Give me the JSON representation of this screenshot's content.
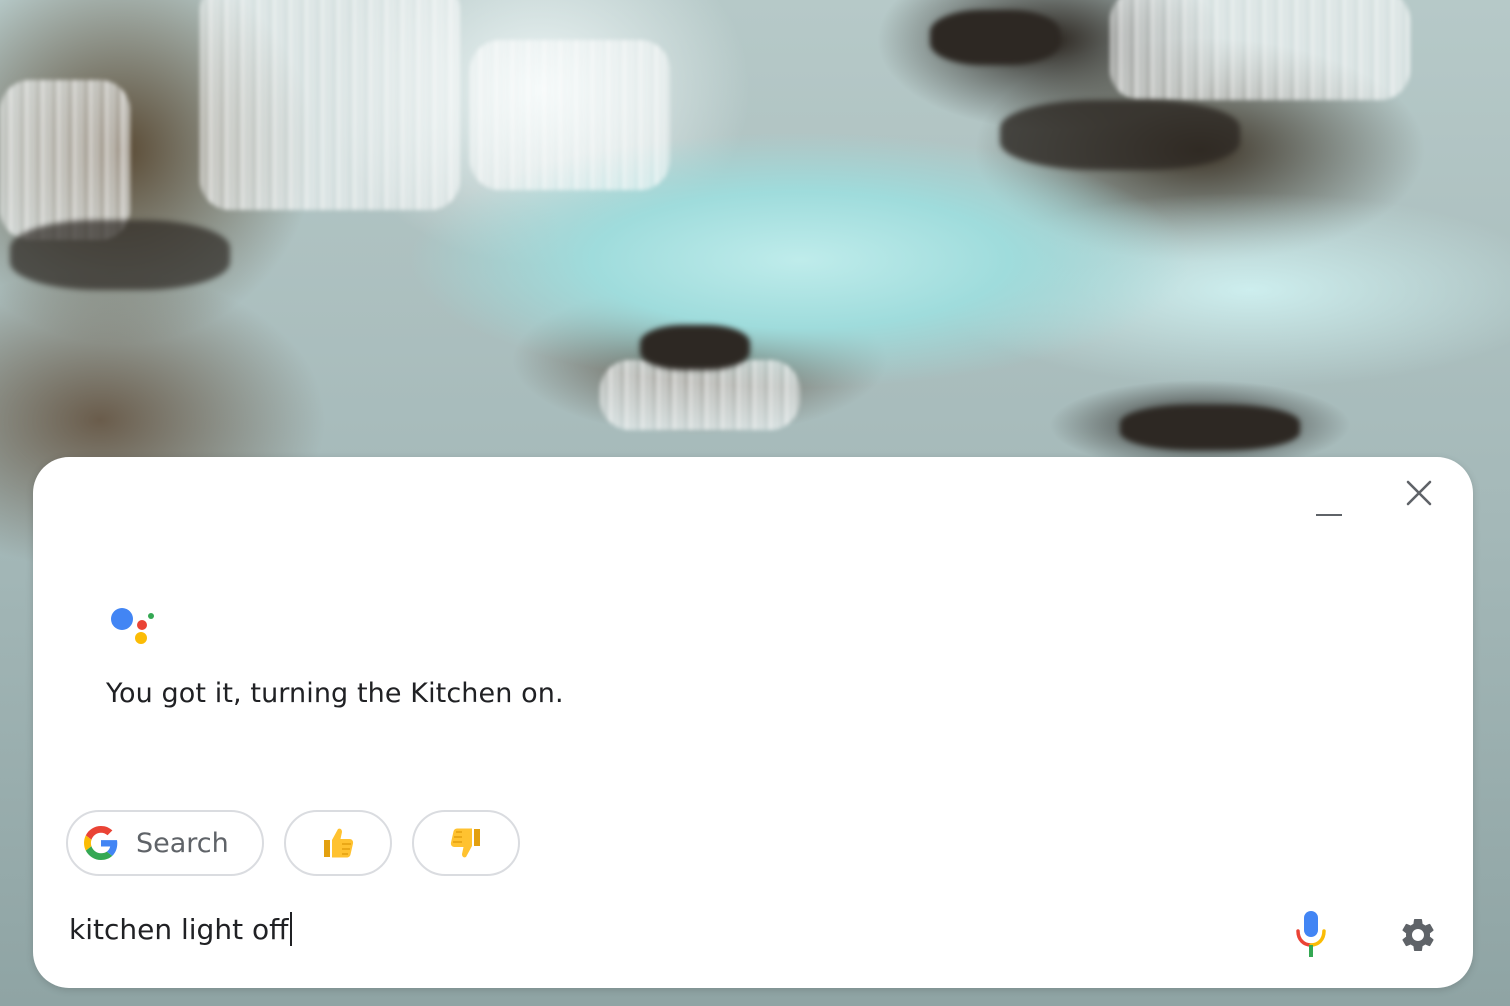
{
  "wallpaper": {
    "description_icon": "waterfall-wallpaper"
  },
  "assistant": {
    "window_controls": {
      "minimize_icon": "minimize-icon",
      "close_icon": "close-icon"
    },
    "logo_icon": "google-assistant-icon",
    "logo_colors": [
      "#4285F4",
      "#EA4335",
      "#FBBC05",
      "#34A853"
    ],
    "response": "You got it, turning the Kitchen on.",
    "suggestions": {
      "search_label": "Search",
      "search_icon": "google-g-icon",
      "thumbs_up_icon": "thumbs-up-icon",
      "thumbs_down_icon": "thumbs-down-icon"
    },
    "input": {
      "value": "kitchen light off"
    },
    "mic_icon": "microphone-icon",
    "settings_icon": "gear-icon"
  }
}
